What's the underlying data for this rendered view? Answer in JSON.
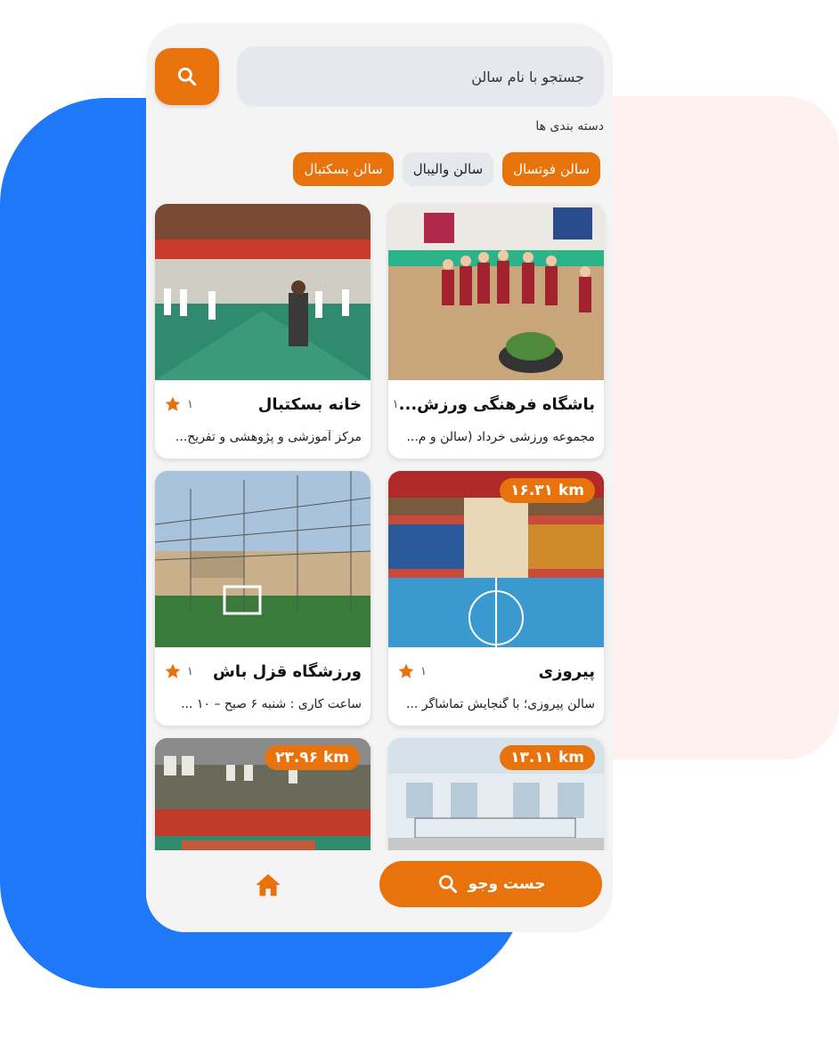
{
  "search": {
    "placeholder": "جستجو با نام سالن"
  },
  "categories": {
    "label": "دسته بندی ها",
    "items": [
      {
        "label": "سالن فوتسال",
        "active": true
      },
      {
        "label": "سالن والیبال",
        "active": false
      },
      {
        "label": "سالن بسکتبال",
        "active": true
      }
    ]
  },
  "cards": [
    {
      "title": "باشگاه فرهنگی ورزش...",
      "rating": "۱",
      "desc": "مجموعه ورزشی خرداد  (سالن و م...",
      "distance": ""
    },
    {
      "title": "خانه بسکتبال",
      "rating": "۱",
      "desc": "مرکز آموزشی و پژوهشی و تفریح...",
      "distance": ""
    },
    {
      "title": "پیروزی",
      "rating": "۱",
      "desc": "سالن پیروزی؛ با گنجایش تماشاگر ...",
      "distance": "۱۶.۳۱ km"
    },
    {
      "title": "ورزشگاه قزل باش",
      "rating": "۱",
      "desc": "ساعت کاری  : شنبه ۶ صبح – ۱۰ ...",
      "distance": ""
    },
    {
      "title": "",
      "rating": "",
      "desc": "",
      "distance": "۱۳.۱۱ km"
    },
    {
      "title": "",
      "rating": "",
      "desc": "",
      "distance": "۲۳.۹۶ km"
    }
  ],
  "bottom_nav": {
    "search_label": "جست وجو"
  },
  "colors": {
    "accent": "#e8720c",
    "blue_bg": "#1f78f7",
    "pink_bg": "#fff1ee"
  }
}
